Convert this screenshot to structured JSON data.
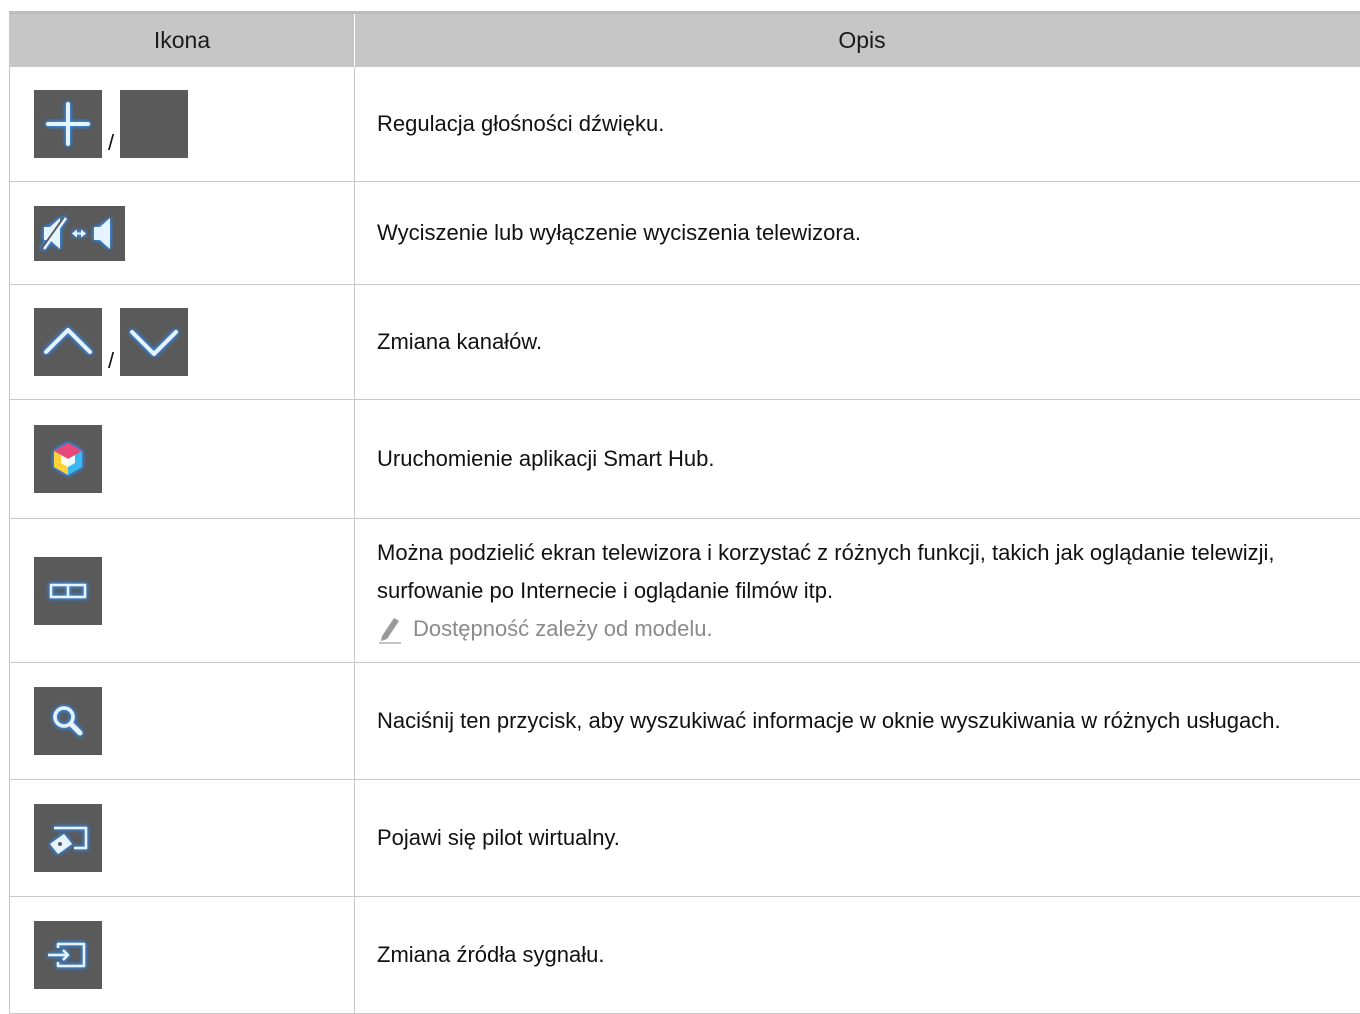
{
  "table": {
    "headers": {
      "icon": "Ikona",
      "description": "Opis"
    },
    "separator": "/",
    "rows": [
      {
        "icons": [
          "plus-icon",
          "minus-icon"
        ],
        "text": "Regulacja głośności dźwięku."
      },
      {
        "icons": [
          "mute-toggle-icon"
        ],
        "text": "Wyciszenie lub wyłączenie wyciszenia telewizora."
      },
      {
        "icons": [
          "chevron-up-icon",
          "chevron-down-icon"
        ],
        "text": "Zmiana kanałów."
      },
      {
        "icons": [
          "smart-hub-icon"
        ],
        "text": "Uruchomienie aplikacji Smart Hub."
      },
      {
        "icons": [
          "split-screen-icon"
        ],
        "text": "Można podzielić ekran telewizora i korzystać z różnych funkcji, takich jak oglądanie telewizji, surfowanie po Internecie i oglądanie filmów itp.",
        "note": "Dostępność zależy od modelu."
      },
      {
        "icons": [
          "search-icon"
        ],
        "text": "Naciśnij ten przycisk, aby wyszukiwać informacje w oknie wyszukiwania w różnych usługach."
      },
      {
        "icons": [
          "virtual-remote-icon"
        ],
        "text": "Pojawi się pilot wirtualny."
      },
      {
        "icons": [
          "source-input-icon"
        ],
        "text": "Zmiana źródła sygnału."
      }
    ]
  },
  "colors": {
    "key_bg": "#5a5a5a",
    "glyph": "#e6f4ff",
    "glow": "#2f8fff",
    "header_bg": "#c6c6c6",
    "note_text": "#8a8a8a"
  }
}
